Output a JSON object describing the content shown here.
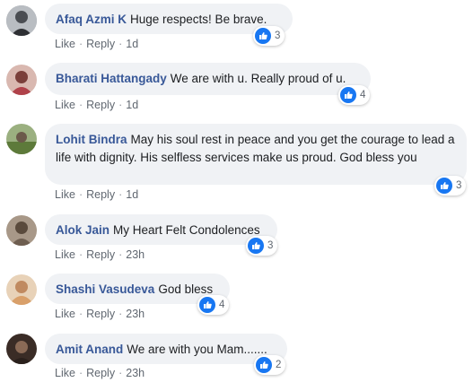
{
  "actions": {
    "like_label": "Like",
    "reply_label": "Reply",
    "separator": "·"
  },
  "comments": [
    {
      "author": "Afaq Azmi K",
      "text": "Huge respects! Be brave.",
      "time": "1d",
      "reactions": "3",
      "avatar_color": "#8a8f96"
    },
    {
      "author": "Bharati Hattangady",
      "text": "We are with u. Really proud of u.",
      "time": "1d",
      "reactions": "4",
      "avatar_color": "#b46a6e"
    },
    {
      "author": "Lohit Bindra",
      "text": "May his soul rest in peace and you get the courage to lead a life with dignity. His selfless services make us proud. God bless you",
      "time": "1d",
      "reactions": "3",
      "avatar_color": "#6b8a4a"
    },
    {
      "author": "Alok Jain",
      "text": "My Heart Felt Condolences",
      "time": "23h",
      "reactions": "3",
      "avatar_color": "#7a6a5a"
    },
    {
      "author": "Shashi Vasudeva",
      "text": "God bless",
      "time": "23h",
      "reactions": "4",
      "avatar_color": "#c9a27a"
    },
    {
      "author": "Amit Anand",
      "text": "We are with you Mam.......",
      "time": "23h",
      "reactions": "2",
      "avatar_color": "#4a3a32"
    }
  ],
  "colors": {
    "author": "#385898",
    "bubble": "#f0f2f5",
    "like_badge": "#1877f2",
    "meta": "#606770"
  },
  "icons": {
    "reaction": "thumbs-up-icon"
  }
}
